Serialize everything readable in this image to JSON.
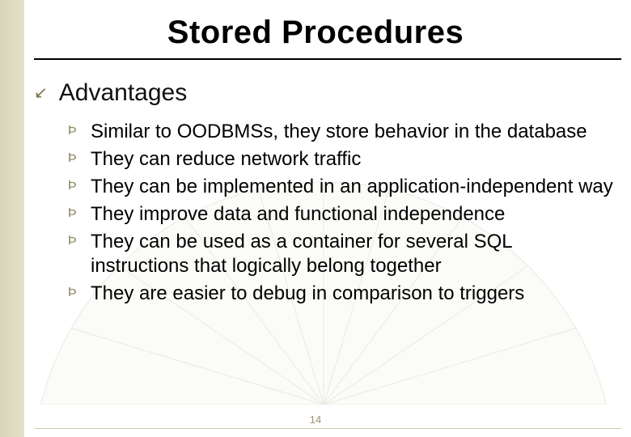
{
  "slide": {
    "title": "Stored Procedures",
    "subtitle": "Advantages",
    "page_number": "14",
    "arrow_bullet_glyph": "↙",
    "sub_bullet_glyph": "Þ",
    "items": [
      "Similar to OODBMSs, they store behavior in the database",
      "They can reduce network traffic",
      "They can be implemented in an application-independent way",
      "They improve data and functional independence",
      "They can be used as a container for several SQL instructions that logically belong together",
      "They are easier to debug in comparison to triggers"
    ]
  }
}
